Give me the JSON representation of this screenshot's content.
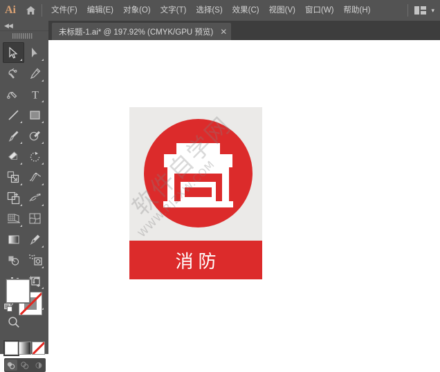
{
  "app": {
    "name": "Ai",
    "logo_color": "#d9a173",
    "chrome_bg": "#535353"
  },
  "menubar": {
    "home_icon": "home-icon",
    "items": [
      {
        "label": "文件(F)"
      },
      {
        "label": "编辑(E)"
      },
      {
        "label": "对象(O)"
      },
      {
        "label": "文字(T)"
      },
      {
        "label": "选择(S)"
      },
      {
        "label": "效果(C)"
      },
      {
        "label": "视图(V)"
      },
      {
        "label": "窗口(W)"
      },
      {
        "label": "帮助(H)"
      }
    ],
    "workspace_icon": "workspace-layout-icon",
    "workspace_chevron": "▾"
  },
  "tabbar": {
    "tab_title": "未标题-1.ai* @ 197.92% (CMYK/GPU 预览)",
    "close_glyph": "✕"
  },
  "toolpanel": {
    "collapse_glyph": "◀◀",
    "grip_icon": "drag-grip-icon",
    "tools": [
      {
        "name": "selection-tool",
        "active": true,
        "corner": true
      },
      {
        "name": "direct-selection-tool",
        "active": false,
        "corner": true
      },
      {
        "name": "magic-wand-tool",
        "active": false,
        "corner": false
      },
      {
        "name": "pen-tool",
        "active": false,
        "corner": true
      },
      {
        "name": "curvature-tool",
        "active": false,
        "corner": false
      },
      {
        "name": "type-tool",
        "active": false,
        "corner": true
      },
      {
        "name": "line-segment-tool",
        "active": false,
        "corner": true
      },
      {
        "name": "rectangle-tool",
        "active": false,
        "corner": true
      },
      {
        "name": "paintbrush-tool",
        "active": false,
        "corner": true
      },
      {
        "name": "shaper-tool",
        "active": false,
        "corner": true
      },
      {
        "name": "eraser-tool",
        "active": false,
        "corner": true
      },
      {
        "name": "rotate-tool",
        "active": false,
        "corner": true
      },
      {
        "name": "scale-tool",
        "active": false,
        "corner": true
      },
      {
        "name": "width-tool",
        "active": false,
        "corner": true
      },
      {
        "name": "free-transform-tool",
        "active": false,
        "corner": true
      },
      {
        "name": "shape-builder-tool",
        "active": false,
        "corner": true
      },
      {
        "name": "perspective-grid-tool",
        "active": false,
        "corner": true
      },
      {
        "name": "mesh-tool",
        "active": false,
        "corner": false
      },
      {
        "name": "gradient-tool",
        "active": false,
        "corner": false
      },
      {
        "name": "eyedropper-tool",
        "active": false,
        "corner": true
      },
      {
        "name": "blend-tool",
        "active": false,
        "corner": false
      },
      {
        "name": "symbol-sprayer-tool",
        "active": false,
        "corner": true
      },
      {
        "name": "column-graph-tool",
        "active": false,
        "corner": true
      },
      {
        "name": "artboard-tool",
        "active": false,
        "corner": true
      },
      {
        "name": "slice-tool",
        "active": false,
        "corner": true
      },
      {
        "name": "hand-tool",
        "active": false,
        "corner": true
      },
      {
        "name": "zoom-tool",
        "active": false,
        "corner": false
      }
    ],
    "fill_color": "#ffffff",
    "stroke_color": "none",
    "swap_icon": "swap-fill-stroke-icon",
    "default_icon": "default-fill-stroke-icon",
    "swatches": [
      {
        "name": "color-swatch-solid",
        "selected": true
      },
      {
        "name": "color-swatch-gradient",
        "selected": false
      },
      {
        "name": "color-swatch-none",
        "selected": false
      }
    ],
    "draw_modes": [
      {
        "name": "draw-normal-mode",
        "active": true
      },
      {
        "name": "draw-behind-mode",
        "active": false
      },
      {
        "name": "draw-inside-mode",
        "active": false
      }
    ]
  },
  "artwork": {
    "accent_red": "#dc2b2b",
    "board_bg": "#ebeae8",
    "icon_name": "fire-station-shop-icon",
    "label": "消防",
    "label_color": "#ffffff",
    "watermark_cn": "软件自学网",
    "watermark_url": "WWW.RJZXW.COM"
  }
}
